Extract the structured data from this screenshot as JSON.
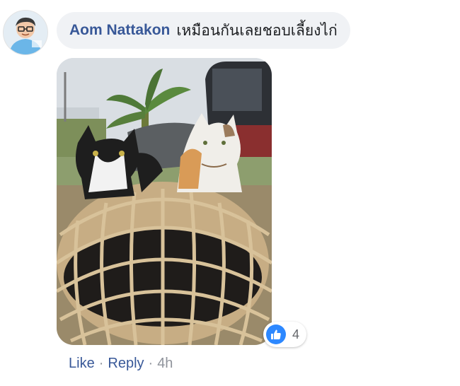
{
  "comment": {
    "author": "Aom Nattakon",
    "text": "เหมือนกันเลยชอบเลี้ยงไก่"
  },
  "reactions": {
    "icon": "like-icon",
    "count": "4",
    "color": "#2d88ff"
  },
  "actions": {
    "like_label": "Like",
    "reply_label": "Reply",
    "separator": "·",
    "time": "4h"
  },
  "colors": {
    "author": "#385898",
    "bubble_bg": "#f0f2f5",
    "meta": "#90949c"
  }
}
